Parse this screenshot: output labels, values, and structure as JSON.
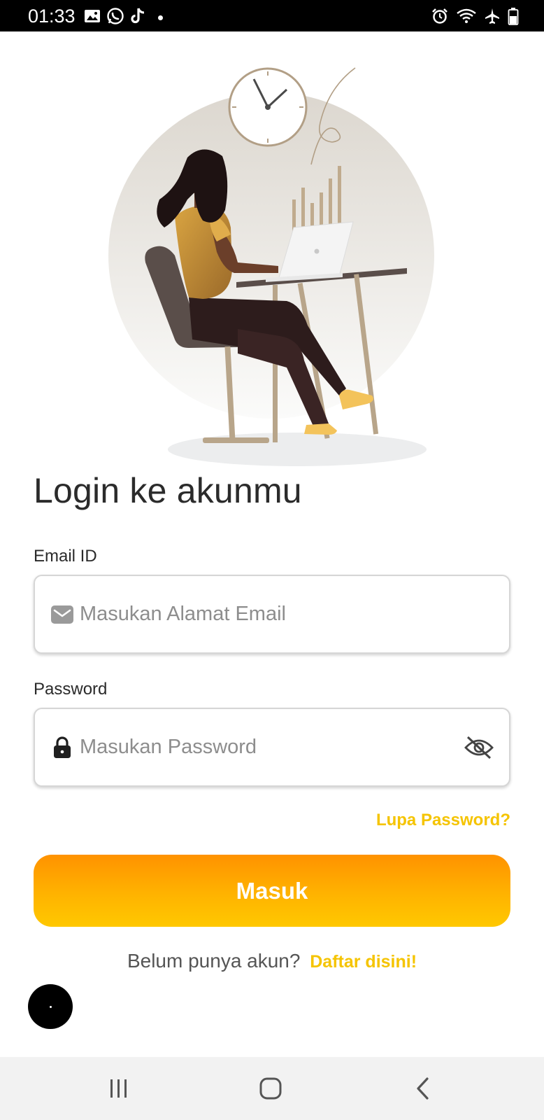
{
  "status_bar": {
    "time": "01:33",
    "left_icons": [
      "gallery-icon",
      "whatsapp-icon",
      "tiktok-icon",
      "dot-icon"
    ],
    "right_icons": [
      "alarm-icon",
      "wifi-icon",
      "airplane-icon",
      "battery-icon"
    ]
  },
  "hero": {
    "illustration": "woman-working-at-laptop-illustration"
  },
  "login": {
    "title": "Login ke akunmu",
    "email_label": "Email ID",
    "email_placeholder": "Masukan Alamat Email",
    "password_label": "Password",
    "password_placeholder": "Masukan Password",
    "forgot_password": "Lupa Password?",
    "submit_label": "Masuk",
    "signup_prompt": "Belum punya akun?",
    "signup_link": "Daftar disini!"
  },
  "colors": {
    "accent_yellow": "#f5c400",
    "button_gradient_top": "#ff9200",
    "button_gradient_bottom": "#ffc800"
  },
  "nav_bar": {
    "buttons": [
      "recent-apps-icon",
      "home-icon",
      "back-icon"
    ]
  }
}
